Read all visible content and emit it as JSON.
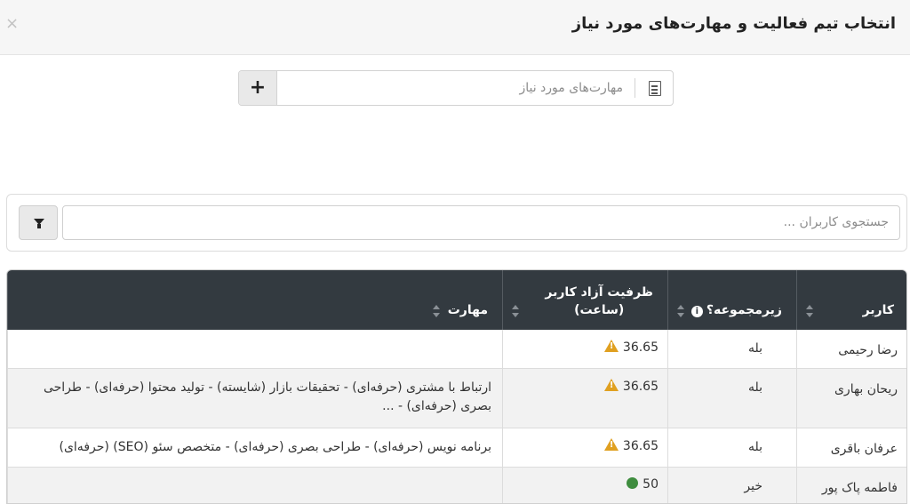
{
  "dialog": {
    "title": "انتخاب تیم فعالیت و مهارت‌های مورد نیاز",
    "close_glyph": "×"
  },
  "skills_field": {
    "placeholder": "مهارت‌های مورد نیاز",
    "add_glyph": "+",
    "icon": "document-icon"
  },
  "user_search": {
    "placeholder": "جستجوی کاربران ...",
    "filter_icon": "funnel-icon"
  },
  "table": {
    "columns": {
      "user": "کاربر",
      "subset": "زیرمجموعه؟",
      "capacity_line1": "ظرفیت آزاد کاربر",
      "capacity_line2": "(ساعت)",
      "skill": "مهارت"
    },
    "rows": [
      {
        "user": "رضا رحیمی",
        "subset": "بله",
        "capacity": "36.65",
        "status": "warning",
        "skill": ""
      },
      {
        "user": "ریحان بهاری",
        "subset": "بله",
        "capacity": "36.65",
        "status": "warning",
        "skill": "ارتباط با مشتری (حرفه‌ای) - تحقیقات بازار (شایسته) - تولید محتوا (حرفه‌ای) - طراحی بصری (حرفه‌ای) - ..."
      },
      {
        "user": "عرفان باقری",
        "subset": "بله",
        "capacity": "36.65",
        "status": "warning",
        "skill": "برنامه نویس (حرفه‌ای) - طراحی بصری (حرفه‌ای) - متخصص سئو (SEO) (حرفه‌ای)"
      },
      {
        "user": "فاطمه پاک پور",
        "subset": "خیر",
        "capacity": "50",
        "status": "ok",
        "skill": ""
      }
    ]
  },
  "colors": {
    "header_bg": "#333a40",
    "warning": "#e0a020",
    "ok": "#3f8d3f"
  }
}
